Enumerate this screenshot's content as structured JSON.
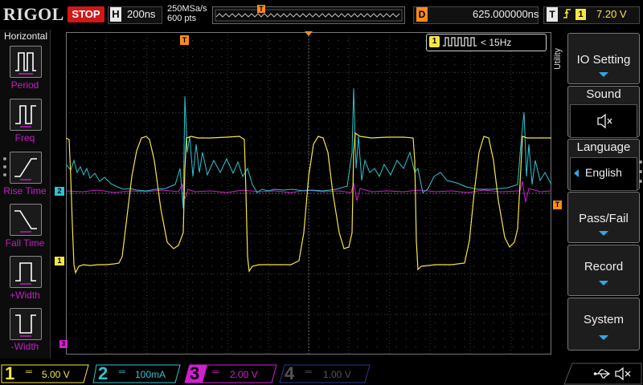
{
  "topbar": {
    "logo": "RIGOL",
    "run_state": "STOP",
    "horizontal_letter": "H",
    "timebase": "200ns",
    "sample_rate": "250MSa/s",
    "memory_depth": "600 pts",
    "delay_letter": "D",
    "delay": "625.000000ns",
    "trigger_letter": "T",
    "trigger_source": "1",
    "trigger_level": "7.20 V"
  },
  "left_menu": {
    "title": "Horizontal",
    "items": [
      {
        "label": "Period",
        "icon": "period-icon"
      },
      {
        "label": "Freq",
        "icon": "freq-icon"
      },
      {
        "label": "Rise Time",
        "icon": "rise-time-icon"
      },
      {
        "label": "Fall Time",
        "icon": "fall-time-icon"
      },
      {
        "label": "+Width",
        "icon": "plus-width-icon"
      },
      {
        "label": "-Width",
        "icon": "minus-width-icon"
      }
    ]
  },
  "measurement_box": {
    "channel": "1",
    "text": "< 15Hz"
  },
  "markers": {
    "trigger_position": "T",
    "ch2_marker": "2",
    "ch1_marker": "1",
    "ch3_marker": "3",
    "trigger_level_marker": "T"
  },
  "right_menu": {
    "side_label": "Utility",
    "items": [
      {
        "label": "IO Setting"
      },
      {
        "label": "Sound"
      },
      {
        "label": "Language",
        "value": "English"
      },
      {
        "label": "Pass/Fail"
      },
      {
        "label": "Record"
      },
      {
        "label": "System"
      }
    ]
  },
  "channels": [
    {
      "number": "1",
      "scale": "5.00 V",
      "color": "#f5e642"
    },
    {
      "number": "2",
      "scale": "100mA",
      "color": "#2ec4d0"
    },
    {
      "number": "3",
      "scale": "2.00 V",
      "color": "#d21ed2"
    },
    {
      "number": "4",
      "scale": "1.00 V",
      "color": "#3c55c8"
    }
  ],
  "colors": {
    "ch1": "#f5e642",
    "ch2": "#2ec4d0",
    "ch3": "#d21ed2",
    "ch4": "#3c55c8",
    "trigger": "#ff8a1c",
    "accent": "#2ea8e8",
    "stop": "#d01818"
  }
}
